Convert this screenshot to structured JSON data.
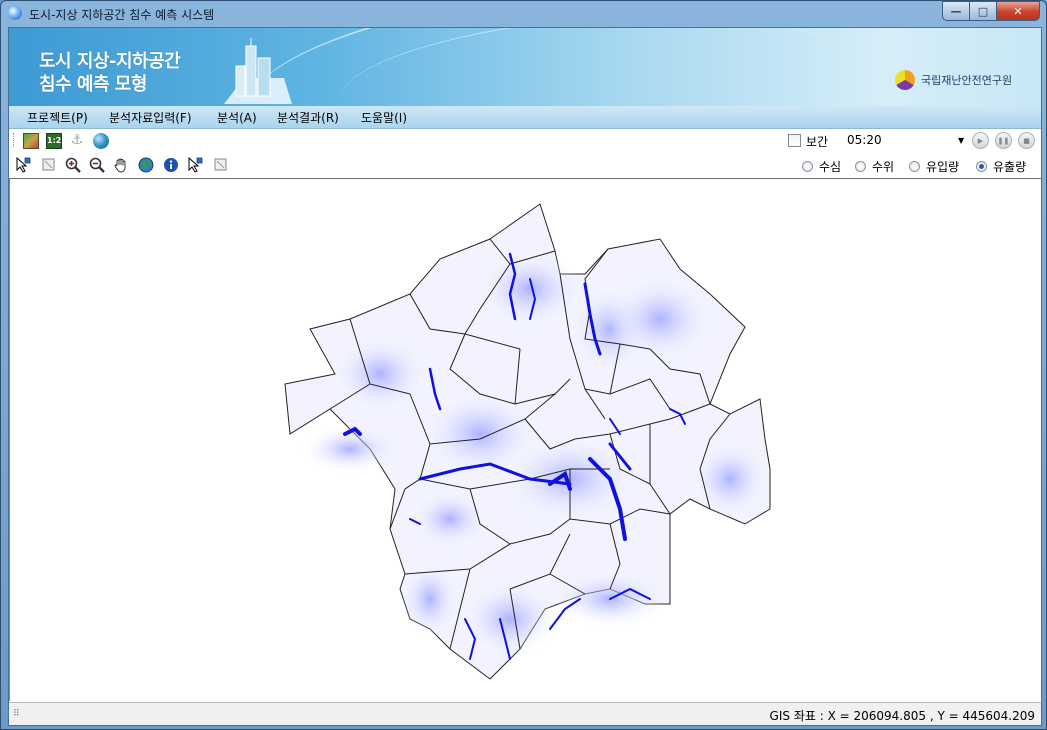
{
  "window": {
    "title": "도시-지상 지하공간 침수 예측 시스템",
    "buttons": {
      "minimize": "—",
      "maximize": "□",
      "close": "✕"
    }
  },
  "banner": {
    "title_line1": "도시 지상-지하공간",
    "title_line2": "침수 예측 모형",
    "org_name": "국립재난안전연구원"
  },
  "menu": [
    {
      "label": "프로젝트(P)"
    },
    {
      "label": "분석자료입력(F)"
    },
    {
      "label": "분석(A)"
    },
    {
      "label": "분석결과(R)"
    },
    {
      "label": "도움말(I)"
    }
  ],
  "toolbar": {
    "icons": [
      "map-layer-icon",
      "scale-12-icon",
      "anchor-icon",
      "globe-icon"
    ],
    "interp_label": "보간",
    "interp_checked": false,
    "time_value": "05:20",
    "play_buttons": [
      "play-icon",
      "pause-icon",
      "stop-icon"
    ]
  },
  "map_tools": [
    "select-pointer-icon",
    "clear-selection-icon",
    "zoom-in-icon",
    "zoom-out-icon",
    "pan-hand-icon",
    "full-extent-globe-icon",
    "info-icon",
    "select-pointer-2-icon",
    "clear-selection-2-icon"
  ],
  "view_mode": {
    "options": [
      {
        "label": "수심",
        "selected": false
      },
      {
        "label": "수위",
        "selected": false
      },
      {
        "label": "유입량",
        "selected": false
      },
      {
        "label": "유출량",
        "selected": true
      }
    ]
  },
  "status": {
    "coord_text": "GIS 좌표 : X = 206094.805 , Y = 445604.209"
  },
  "colors": {
    "flood_dark": "#1010e0",
    "flood_light": "#c8ccff",
    "boundary": "#222222"
  }
}
